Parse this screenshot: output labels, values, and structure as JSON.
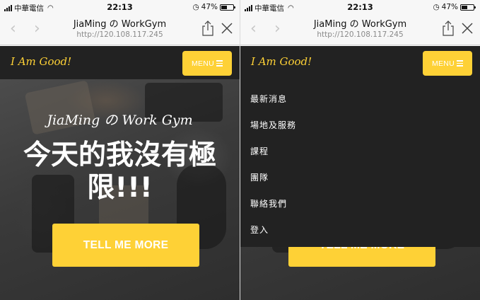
{
  "status_bar": {
    "carrier": "中華電信",
    "time": "22:13",
    "battery_percent": "47%"
  },
  "browser": {
    "title": "JiaMing の WorkGym",
    "url": "http://120.108.117.245"
  },
  "site": {
    "brand": "I Am Good!",
    "menu_label": "MENU",
    "hero_subtitle": "JiaMing の Work Gym",
    "hero_heading": "今天的我沒有極限!!!",
    "cta_label": "TELL ME MORE",
    "accent_color": "#fed136"
  },
  "menu": {
    "items": [
      {
        "label": "最新消息"
      },
      {
        "label": "場地及服務"
      },
      {
        "label": "課程"
      },
      {
        "label": "團隊"
      },
      {
        "label": "聯絡我們"
      },
      {
        "label": "登入"
      }
    ]
  },
  "icons": [
    "signal-icon",
    "wifi-icon",
    "alarm-icon",
    "battery-icon",
    "back-arrow-icon",
    "forward-arrow-icon",
    "share-icon",
    "close-icon",
    "hamburger-icon"
  ]
}
